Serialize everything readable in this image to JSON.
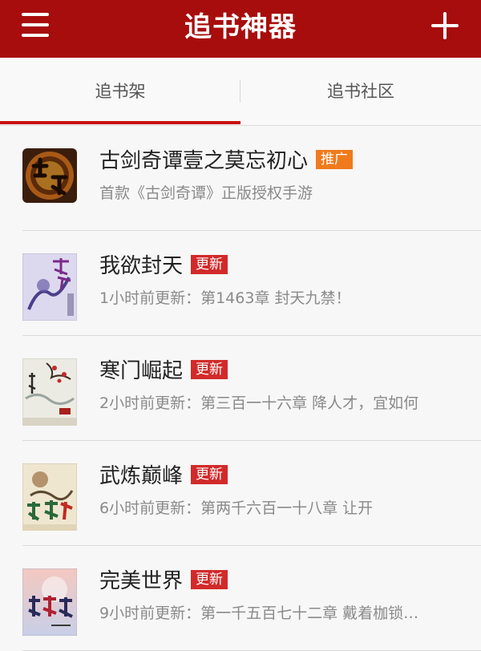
{
  "header": {
    "title": "追书神器",
    "menu_icon": "hamburger-menu-icon",
    "add_icon": "plus-icon",
    "bg_color": "#a70d0c"
  },
  "tabs": [
    {
      "label": "追书架",
      "active": true
    },
    {
      "label": "追书社区",
      "active": false
    }
  ],
  "accent_color": "#c9100f",
  "books": [
    {
      "title": "古剑奇谭壹之莫忘初心",
      "badge": "推广",
      "badge_type": "promo",
      "subtitle": "首款《古剑奇谭》正版授权手游"
    },
    {
      "title": "我欲封天",
      "badge": "更新",
      "badge_type": "update",
      "subtitle": "1小时前更新：第1463章 封天九禁！"
    },
    {
      "title": "寒门崛起",
      "badge": "更新",
      "badge_type": "update",
      "subtitle": "2小时前更新：第三百一十六章 降人才，宜如何"
    },
    {
      "title": "武炼巅峰",
      "badge": "更新",
      "badge_type": "update",
      "subtitle": "6小时前更新：第两千六百一十八章 让开"
    },
    {
      "title": "完美世界",
      "badge": "更新",
      "badge_type": "update",
      "subtitle": "9小时前更新：第一千五百七十二章 戴着枷锁…"
    }
  ]
}
